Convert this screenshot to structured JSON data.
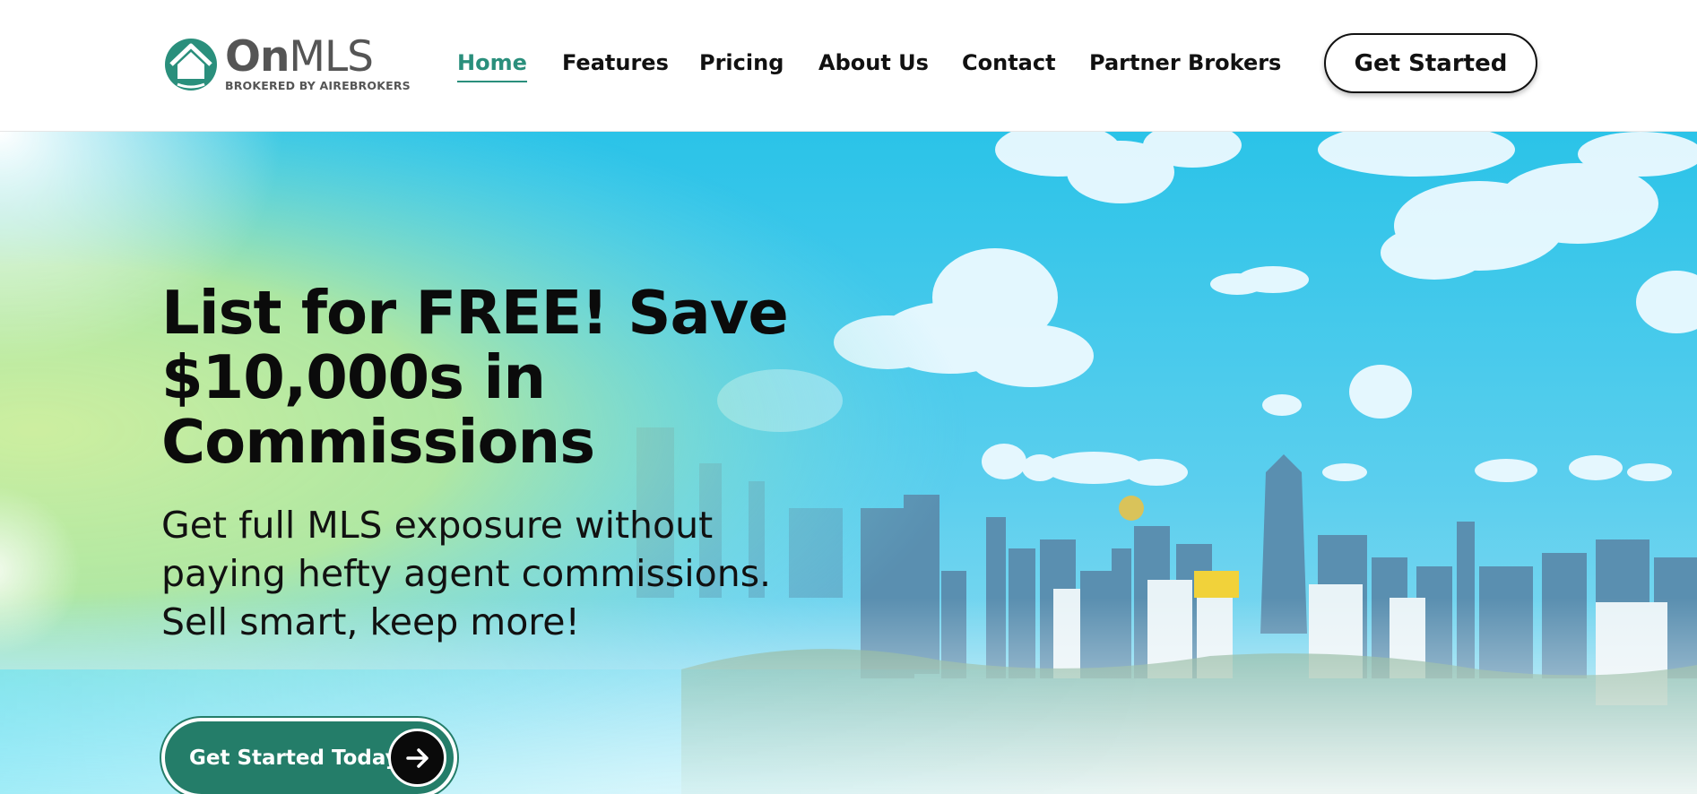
{
  "brand": {
    "name_bold": "On",
    "name_light": "MLS",
    "tagline": "BROKERED BY AIREBROKERS",
    "primary_color": "#2a8f7c"
  },
  "nav": {
    "items": [
      {
        "label": "Home",
        "active": true
      },
      {
        "label": "Features",
        "active": false
      },
      {
        "label": "Pricing",
        "active": false
      },
      {
        "label": "About Us",
        "active": false
      },
      {
        "label": "Contact",
        "active": false
      },
      {
        "label": "Partner Brokers",
        "active": false
      }
    ],
    "cta_label": "Get Started"
  },
  "hero": {
    "title": "List for FREE! Save $10,000s in Commissions",
    "subtitle": "Get full MLS exposure without paying hefty agent commissions. Sell smart, keep more!",
    "cta_label": "Get Started Today",
    "cta_icon": "arrow-right-icon",
    "button_color": "#247d69"
  }
}
